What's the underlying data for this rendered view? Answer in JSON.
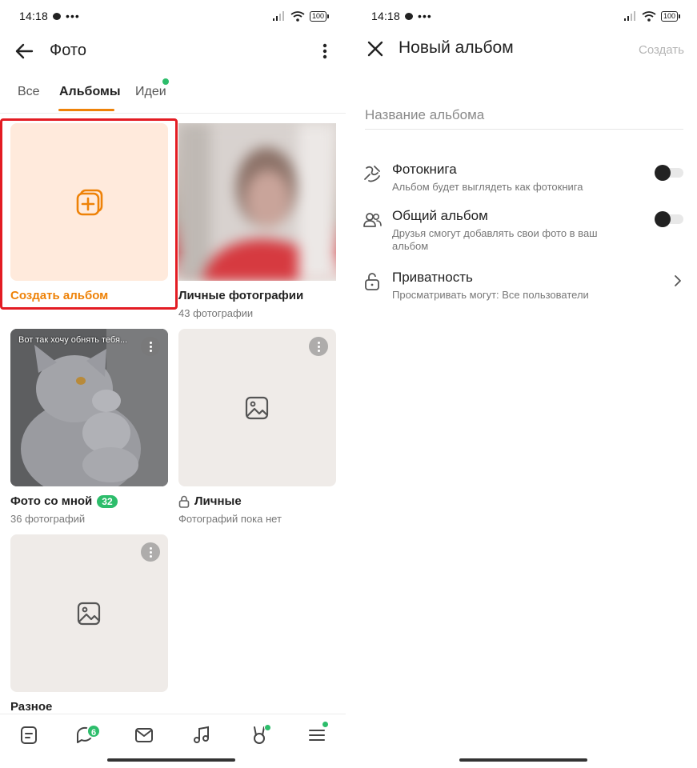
{
  "status": {
    "time": "14:18",
    "dots": "•••",
    "battery": "100"
  },
  "left": {
    "title": "Фото",
    "tabs": [
      {
        "label": "Все"
      },
      {
        "label": "Альбомы"
      },
      {
        "label": "Идеи"
      }
    ],
    "create_album": {
      "label": "Создать альбом"
    },
    "albums": [
      {
        "name": "Личные фотографии",
        "count": "43 фотографии"
      },
      {
        "name": "Фото со мной",
        "badge": "32",
        "count": "36 фотографий",
        "caption": "Вот так хочу обнять тебя..."
      },
      {
        "name": "Личные",
        "count": "Фотографий пока нет"
      },
      {
        "name": "Разное"
      }
    ],
    "nav": {
      "chat_badge": "6"
    }
  },
  "right": {
    "title": "Новый альбом",
    "create_button": "Создать",
    "name_placeholder": "Название альбома",
    "options": [
      {
        "label": "Фотокнига",
        "desc": "Альбом будет выглядеть как фотокнига"
      },
      {
        "label": "Общий альбом",
        "desc": "Друзья смогут добавлять свои фото в ваш альбом"
      },
      {
        "label": "Приватность",
        "desc": "Просматривать могут: Все пользователи"
      }
    ]
  },
  "colors": {
    "accent": "#ee8208",
    "green": "#2dbd6b",
    "highlight": "#e31c23"
  }
}
